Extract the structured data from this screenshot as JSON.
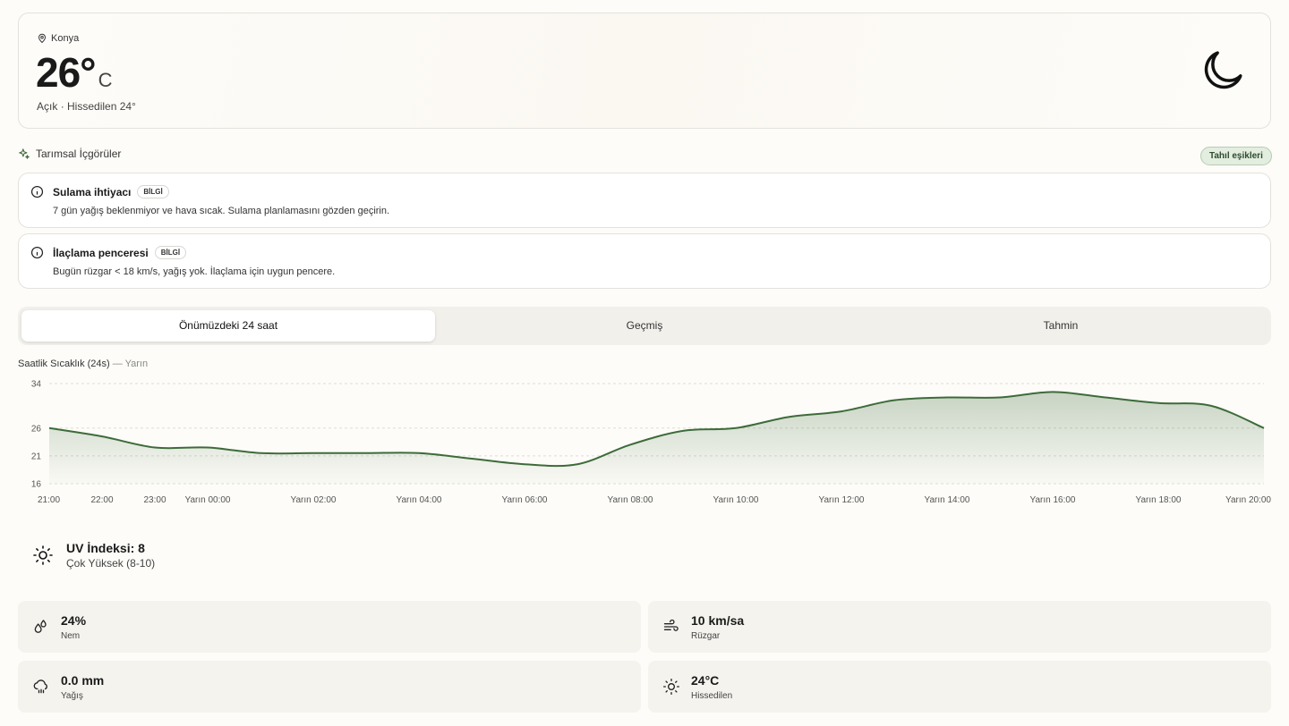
{
  "hero": {
    "location": "Konya",
    "temperature": "26°",
    "unit": "C",
    "condition": "Açık",
    "feels_like": "· Hissedilen 24°",
    "icon": "moon-icon"
  },
  "insights": {
    "header": "Tarımsal İçgörüler",
    "thresholds_button": "Tahıl eşikleri",
    "items": [
      {
        "title": "Sulama ihtiyacı",
        "badge": "BİLGİ",
        "description": "7 gün yağış beklenmiyor ve hava sıcak. Sulama planlamasını gözden geçirin."
      },
      {
        "title": "İlaçlama penceresi",
        "badge": "BİLGİ",
        "description": "Bugün rüzgar < 18 km/s, yağış yok. İlaçlama için uygun pencere."
      }
    ]
  },
  "tabs": [
    {
      "label": "Önümüzdeki 24 saat",
      "active": true
    },
    {
      "label": "Geçmiş",
      "active": false
    },
    {
      "label": "Tahmin",
      "active": false
    }
  ],
  "chart": {
    "title": "Saatlik Sıcaklık (24s)",
    "subtitle": "— Yarın"
  },
  "chart_data": {
    "type": "area",
    "title": "Saatlik Sıcaklık (24s)",
    "x": [
      "21:00",
      "22:00",
      "23:00",
      "Yarın 00:00",
      "Yarın 01:00",
      "Yarın 02:00",
      "Yarın 03:00",
      "Yarın 04:00",
      "Yarın 05:00",
      "Yarın 06:00",
      "Yarın 07:00",
      "Yarın 08:00",
      "Yarın 09:00",
      "Yarın 10:00",
      "Yarın 11:00",
      "Yarın 12:00",
      "Yarın 13:00",
      "Yarın 14:00",
      "Yarın 15:00",
      "Yarın 16:00",
      "Yarın 17:00",
      "Yarın 18:00",
      "Yarın 19:00",
      "Yarın 20:00"
    ],
    "x_tick_labels": [
      "21:00",
      "22:00",
      "23:00",
      "Yarın 00:00",
      "Yarın 02:00",
      "Yarın 04:00",
      "Yarın 06:00",
      "Yarın 08:00",
      "Yarın 10:00",
      "Yarın 12:00",
      "Yarın 14:00",
      "Yarın 16:00",
      "Yarın 18:00",
      "Yarın 20:00"
    ],
    "series": [
      {
        "values": [
          26,
          24.5,
          22.5,
          22.5,
          21.5,
          21.5,
          21.5,
          21.5,
          20.5,
          19.5,
          19.5,
          23,
          25.5,
          26,
          28,
          29,
          31,
          31.5,
          31.5,
          32.5,
          31.5,
          30.5,
          30,
          26
        ]
      }
    ],
    "ylim": [
      16,
      34
    ],
    "y_ticks": [
      16,
      21,
      26,
      34
    ],
    "grid": true,
    "color": "#3d6b3a"
  },
  "uv": {
    "title": "UV İndeksi: 8",
    "level": "Çok Yüksek (8-10)"
  },
  "stats": [
    {
      "value": "24%",
      "label": "Nem",
      "icon": "droplets-icon"
    },
    {
      "value": "10 km/sa",
      "label": "Rüzgar",
      "icon": "wind-icon"
    },
    {
      "value": "0.0 mm",
      "label": "Yağış",
      "icon": "cloud-rain-icon"
    },
    {
      "value": "24°C",
      "label": "Hissedilen",
      "icon": "sun-icon"
    }
  ]
}
